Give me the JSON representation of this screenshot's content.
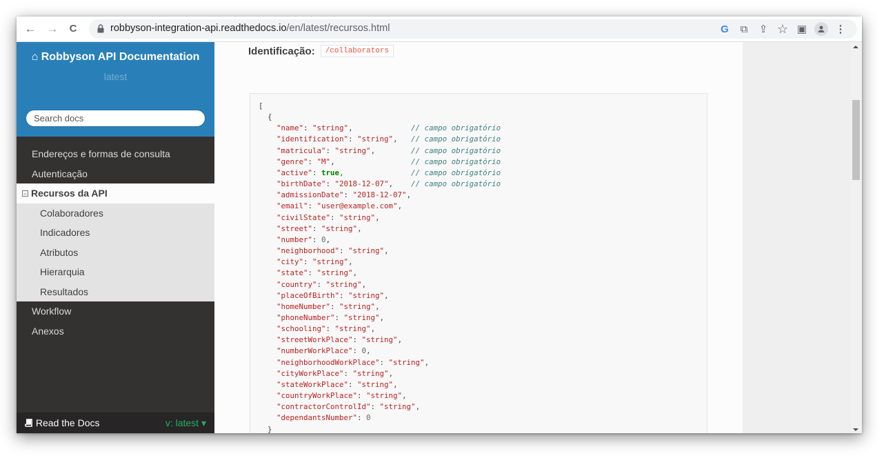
{
  "browser": {
    "back_icon": "←",
    "forward_icon": "→",
    "reload_icon": "C",
    "url_host": "robbyson-integration-api.readthedocs.io",
    "url_path": "/en/latest/recursos.html",
    "toolbar_icons": {
      "google": "G",
      "translate": "⧉",
      "share": "⇪",
      "bookmark": "☆",
      "sidepanel": "▣",
      "menu": "⋮"
    }
  },
  "sidebar": {
    "brand": "Robbyson API Documentation",
    "brand_icon": "⌂",
    "version": "latest",
    "search_placeholder": "Search docs",
    "menu": [
      {
        "label": "Endereços e formas de consulta"
      },
      {
        "label": "Autenticação"
      },
      {
        "label": "Recursos da API",
        "current": true,
        "toggle": "−"
      },
      {
        "label": "Colaboradores",
        "sub": true
      },
      {
        "label": "Indicadores",
        "sub": true
      },
      {
        "label": "Atributos",
        "sub": true
      },
      {
        "label": "Hierarquia",
        "sub": true
      },
      {
        "label": "Resultados",
        "sub": true
      },
      {
        "label": "Workflow"
      },
      {
        "label": "Anexos"
      }
    ],
    "footer": {
      "label": "Read the Docs",
      "version": "v: latest ▾"
    }
  },
  "content": {
    "ident_label": "Identificação:",
    "ident_code": "/collaborators",
    "code_open": "[",
    "obj_open": "{",
    "obj_close": "}",
    "code_close": "]",
    "fields": [
      {
        "key": "name",
        "value": "\"string\"",
        "type": "s",
        "comment": "// campo obrigatório"
      },
      {
        "key": "identification",
        "value": "\"string\"",
        "type": "s",
        "comment": "// campo obrigatório"
      },
      {
        "key": "matricula",
        "value": "\"string\"",
        "type": "s",
        "comment": "// campo obrigatório"
      },
      {
        "key": "genre",
        "value": "\"M\"",
        "type": "s",
        "comment": "// campo obrigatório"
      },
      {
        "key": "active",
        "value": "true",
        "type": "b",
        "comment": "// campo obrigatório"
      },
      {
        "key": "birthDate",
        "value": "\"2018-12-07\"",
        "type": "s",
        "comment": "// campo obrigatório"
      },
      {
        "key": "admissionDate",
        "value": "\"2018-12-07\"",
        "type": "s"
      },
      {
        "key": "email",
        "value": "\"user@example.com\"",
        "type": "s"
      },
      {
        "key": "civilState",
        "value": "\"string\"",
        "type": "s"
      },
      {
        "key": "street",
        "value": "\"string\"",
        "type": "s"
      },
      {
        "key": "number",
        "value": "0",
        "type": "n"
      },
      {
        "key": "neighborhood",
        "value": "\"string\"",
        "type": "s"
      },
      {
        "key": "city",
        "value": "\"string\"",
        "type": "s"
      },
      {
        "key": "state",
        "value": "\"string\"",
        "type": "s"
      },
      {
        "key": "country",
        "value": "\"string\"",
        "type": "s"
      },
      {
        "key": "placeOfBirth",
        "value": "\"string\"",
        "type": "s"
      },
      {
        "key": "homeNumber",
        "value": "\"string\"",
        "type": "s"
      },
      {
        "key": "phoneNumber",
        "value": "\"string\"",
        "type": "s"
      },
      {
        "key": "schooling",
        "value": "\"string\"",
        "type": "s"
      },
      {
        "key": "streetWorkPlace",
        "value": "\"string\"",
        "type": "s"
      },
      {
        "key": "numberWorkPlace",
        "value": "0",
        "type": "n"
      },
      {
        "key": "neighborhoodWorkPlace",
        "value": "\"string\"",
        "type": "s"
      },
      {
        "key": "cityWorkPlace",
        "value": "\"string\"",
        "type": "s"
      },
      {
        "key": "stateWorkPlace",
        "value": "\"string\"",
        "type": "s"
      },
      {
        "key": "countryWorkPlace",
        "value": "\"string\"",
        "type": "s"
      },
      {
        "key": "contractorControlId",
        "value": "\"string\"",
        "type": "s"
      },
      {
        "key": "dependantsNumber",
        "value": "0",
        "type": "n",
        "last": true
      }
    ]
  }
}
